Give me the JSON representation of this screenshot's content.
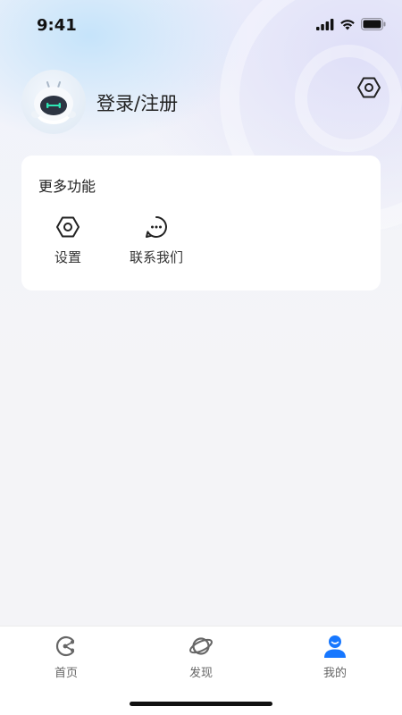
{
  "status_bar": {
    "time": "9:41"
  },
  "profile": {
    "login_label": "登录/注册"
  },
  "more_functions": {
    "title": "更多功能",
    "items": [
      {
        "label": "设置",
        "icon": "settings-hexagon-icon"
      },
      {
        "label": "联系我们",
        "icon": "chat-bubble-icon"
      }
    ]
  },
  "tabbar": {
    "tabs": [
      {
        "label": "首页",
        "icon": "home-share-icon",
        "active": false
      },
      {
        "label": "发现",
        "icon": "planet-icon",
        "active": false
      },
      {
        "label": "我的",
        "icon": "user-icon",
        "active": true
      }
    ]
  },
  "colors": {
    "accent": "#1677ff",
    "background": "#f4f4f7",
    "card": "#ffffff",
    "text": "#222222"
  }
}
